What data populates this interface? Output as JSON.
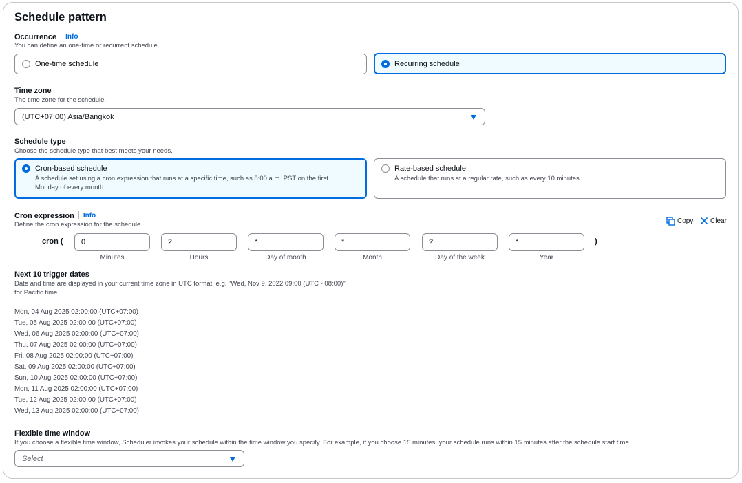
{
  "title": "Schedule pattern",
  "occurrence": {
    "label": "Occurrence",
    "info": "Info",
    "description": "You can define an one-time or recurrent schedule.",
    "options": [
      {
        "label": "One-time schedule",
        "selected": false
      },
      {
        "label": "Recurring schedule",
        "selected": true
      }
    ]
  },
  "timezone": {
    "label": "Time zone",
    "description": "The time zone for the schedule.",
    "value": "(UTC+07:00) Asia/Bangkok"
  },
  "schedule_type": {
    "label": "Schedule type",
    "description": "Choose the schedule type that best meets your needs.",
    "options": [
      {
        "label": "Cron-based schedule",
        "description_line1": "A schedule set using a cron expression that runs at a specific time, such as 8:00 a.m. PST on the first",
        "description_line2": "Monday of every month.",
        "selected": true
      },
      {
        "label": "Rate-based schedule",
        "description_line1": "A schedule that runs at a regular rate, such as every 10 minutes.",
        "selected": false
      }
    ]
  },
  "cron": {
    "label": "Cron expression",
    "info": "Info",
    "description": "Define the cron expression for the schedule",
    "prefix": "cron (",
    "suffix": ")",
    "copy_label": "Copy",
    "clear_label": "Clear",
    "fields": [
      {
        "value": "0",
        "caption": "Minutes"
      },
      {
        "value": "2",
        "caption": "Hours"
      },
      {
        "value": "*",
        "caption": "Day of month"
      },
      {
        "value": "*",
        "caption": "Month"
      },
      {
        "value": "?",
        "caption": "Day of the week"
      },
      {
        "value": "*",
        "caption": "Year"
      }
    ]
  },
  "trigger_dates": {
    "label": "Next 10 trigger dates",
    "description_line1": "Date and time are displayed in your current time zone in UTC format, e.g. \"Wed, Nov 9, 2022 09:00 (UTC - 08:00)\"",
    "description_line2": "for Pacific time",
    "dates": [
      "Mon, 04 Aug 2025 02:00:00 (UTC+07:00)",
      "Tue, 05 Aug 2025 02:00:00 (UTC+07:00)",
      "Wed, 06 Aug 2025 02:00:00 (UTC+07:00)",
      "Thu, 07 Aug 2025 02:00:00 (UTC+07:00)",
      "Fri, 08 Aug 2025 02:00:00 (UTC+07:00)",
      "Sat, 09 Aug 2025 02:00:00 (UTC+07:00)",
      "Sun, 10 Aug 2025 02:00:00 (UTC+07:00)",
      "Mon, 11 Aug 2025 02:00:00 (UTC+07:00)",
      "Tue, 12 Aug 2025 02:00:00 (UTC+07:00)",
      "Wed, 13 Aug 2025 02:00:00 (UTC+07:00)"
    ]
  },
  "flex_window": {
    "label": "Flexible time window",
    "description": "If you choose a flexible time window, Scheduler invokes your schedule within the time window you specify. For example, if you choose 15 minutes, your schedule runs within 15 minutes after the schedule start time.",
    "placeholder": "Select"
  },
  "colors": {
    "accent": "#006ce0",
    "selected_bg": "#f0fbff",
    "border": "#8c8c94",
    "text": "#0f141a",
    "muted": "#424650"
  },
  "icons": {
    "copy": "copy-icon",
    "clear": "close-icon",
    "dropdown": "caret-down-icon"
  }
}
